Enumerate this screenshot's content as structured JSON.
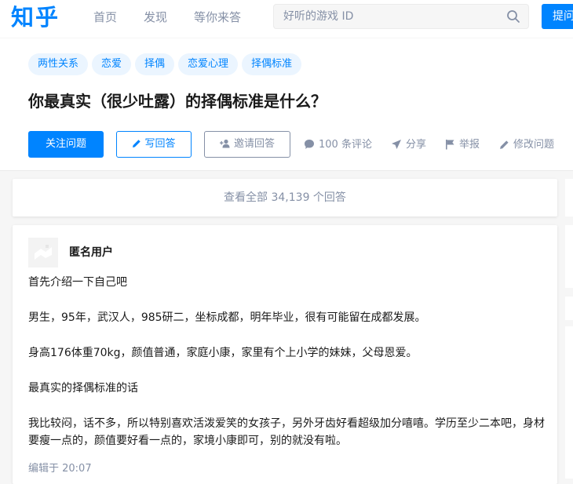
{
  "brand": {
    "logo_text": "知乎",
    "accent": "#0084ff"
  },
  "nav": {
    "items": [
      "首页",
      "发现",
      "等你来答"
    ],
    "search_placeholder": "好听的游戏 ID",
    "ask_label": "提问"
  },
  "question": {
    "tags": [
      "两性关系",
      "恋爱",
      "择偶",
      "恋爱心理",
      "择偶标准"
    ],
    "title": "你最真实（很少吐露）的择偶标准是什么？",
    "follow_label": "关注问题",
    "write_label": "写回答",
    "invite_label": "邀请回答",
    "comments_label": "100 条评论",
    "share_label": "分享",
    "report_label": "举报",
    "edit_label": "修改问题"
  },
  "view_all": "查看全部 34,139 个回答",
  "answer": {
    "author": "匿名用户",
    "paragraphs": [
      "首先介绍一下自己吧",
      "男生，95年，武汉人，985研二，坐标成都，明年毕业，很有可能留在成都发展。",
      "身高176体重70kg，颜值普通，家庭小康，家里有个上小学的妹妹，父母恩爱。",
      "最真实的择偶标准的话",
      "我比较闷，话不多，所以特别喜欢活泼爱笑的女孩子，另外牙齿好看超级加分嘻嘻。学历至少二本吧，身材要瘦一点的，颜值要好看一点的，家境小康即可，别的就没有啦。"
    ],
    "edited": "编辑于 20:07"
  }
}
